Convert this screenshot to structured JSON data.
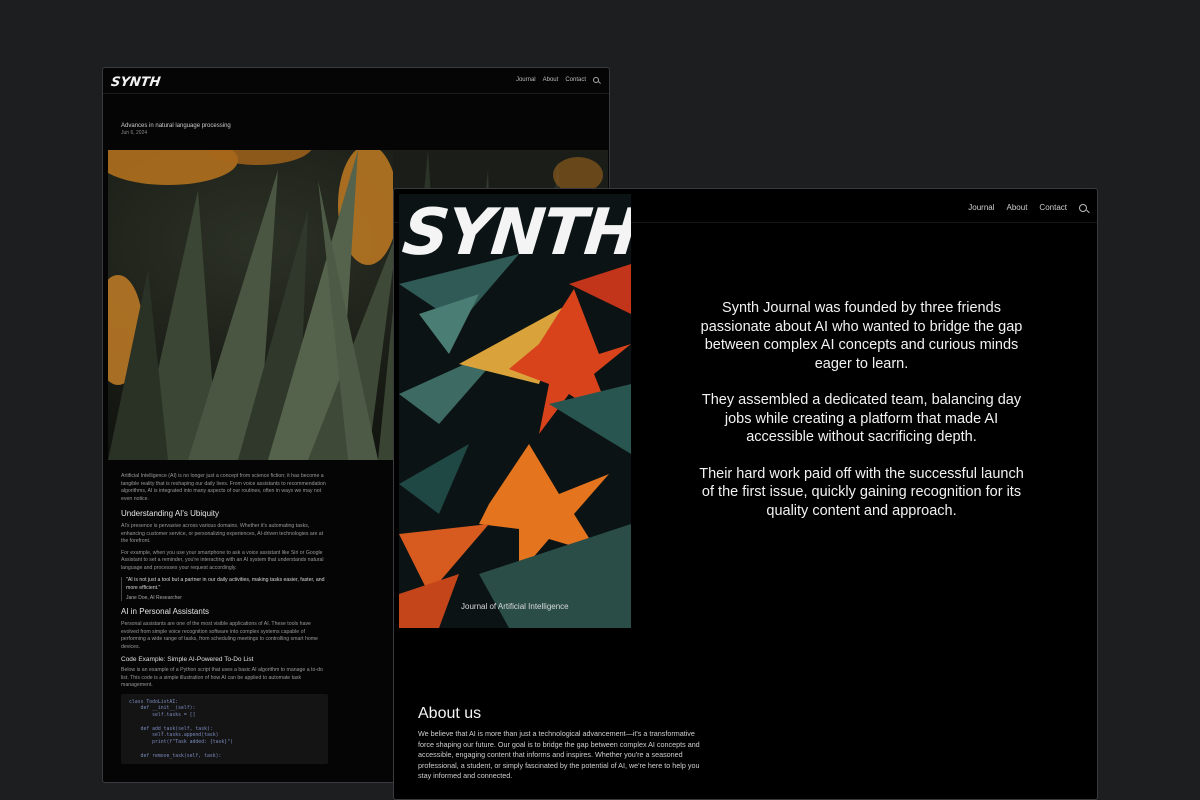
{
  "back_window": {
    "logo": "SYNTH",
    "nav": [
      "Journal",
      "About",
      "Contact"
    ],
    "post_title": "Advances in natural language processing",
    "post_date": "Jun 6, 2024",
    "intro": "Artificial Intelligence (AI) is no longer just a concept from science fiction; it has become a tangible reality that is reshaping our daily lives. From voice assistants to recommendation algorithms, AI is integrated into many aspects of our routines, often in ways we may not even notice.",
    "h2_1": "Understanding AI's Ubiquity",
    "p1": "AI's presence is pervasive across various domains. Whether it's automating tasks, enhancing customer service, or personalizing experiences, AI-driven technologies are at the forefront.",
    "p2": "For example, when you use your smartphone to ask a voice assistant like Siri or Google Assistant to set a reminder, you're interacting with an AI system that understands natural language and processes your request accordingly.",
    "quote": "\"AI is not just a tool but a partner in our daily activities, making tasks easier, faster, and more efficient.\"",
    "quote_author": "Jane Doe, AI Researcher",
    "h2_2": "AI in Personal Assistants",
    "p3": "Personal assistants are one of the most visible applications of AI. These tools have evolved from simple voice recognition software into complex systems capable of performing a wide range of tasks, from scheduling meetings to controlling smart home devices.",
    "h3": "Code Example: Simple AI-Powered To-Do List",
    "p4": "Below is an example of a Python script that uses a basic AI algorithm to manage a to-do list. This code is a simple illustration of how AI can be applied to automate task management.",
    "code": "class TodoListAI:\n    def __init__(self):\n        self.tasks = []\n\n    def add_task(self, task):\n        self.tasks.append(task)\n        print(f\"Task added: {task}\")\n\n    def remove_task(self, task):"
  },
  "front_window": {
    "nav": [
      "Journal",
      "About",
      "Contact"
    ],
    "cover_logo": "SYNTH",
    "cover_caption": "Journal of Artificial Intelligence",
    "paragraphs": [
      "Synth Journal was founded by three friends passionate about AI who wanted to bridge the gap between complex AI concepts and curious minds eager to learn.",
      "They assembled a dedicated team, balancing day jobs while creating a platform that made AI accessible without sacrificing depth.",
      "Their hard work paid off with the successful launch of the first issue, quickly gaining recognition for its quality content and approach."
    ],
    "about_heading": "About us",
    "about_body": "We believe that AI is more than just a technological advancement—it's a transformative force shaping our future. Our goal is to bridge the gap between complex AI concepts and accessible, engaging content that informs and inspires. Whether you're a seasoned professional, a student, or simply fascinated by the potential of AI, we're here to help you stay informed and connected."
  },
  "colors": {
    "background": "#1d1e20",
    "window": "#000000",
    "accent_orange": "#e06a20"
  },
  "icons": [
    "search-icon"
  ]
}
